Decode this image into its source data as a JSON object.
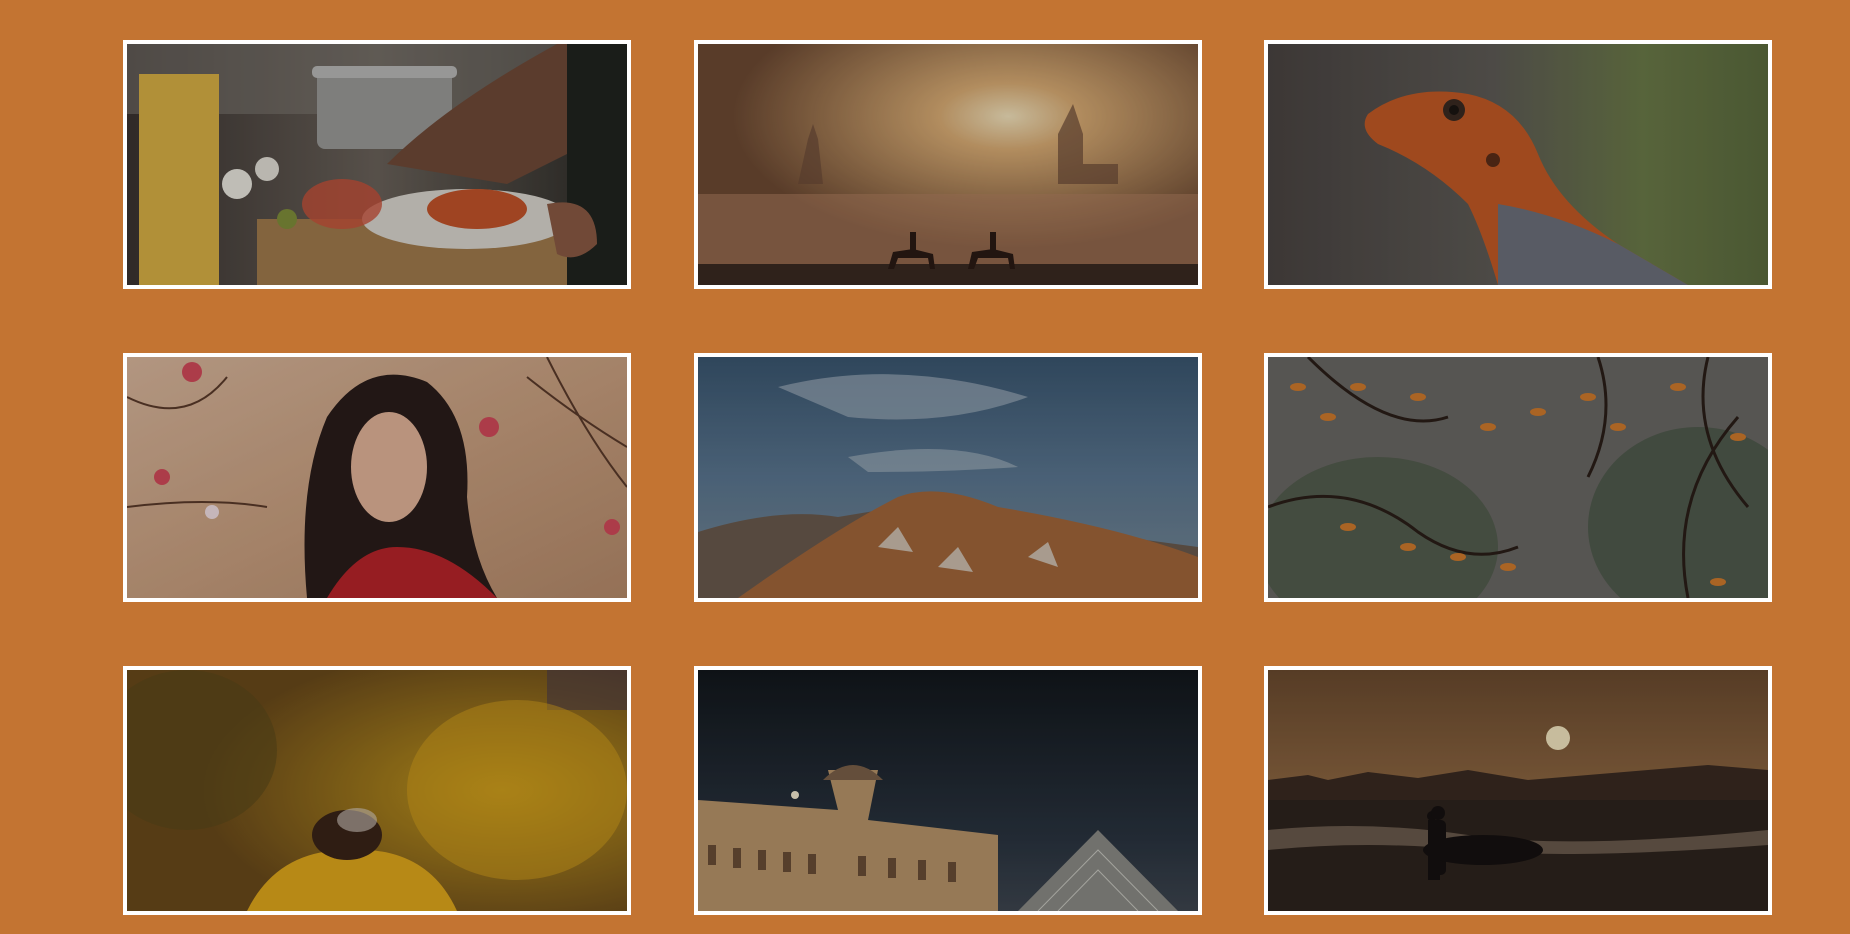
{
  "page": {
    "background": "#c37432",
    "frame_color": "#ffffff"
  },
  "gallery": {
    "tiles": [
      {
        "subject": "chef-plating-pasta",
        "icon": "photo-icon"
      },
      {
        "subject": "horse-riders-misty-sunrise",
        "icon": "photo-icon"
      },
      {
        "subject": "orange-lizard",
        "icon": "photo-icon"
      },
      {
        "subject": "woman-cherry-blossoms",
        "icon": "photo-icon"
      },
      {
        "subject": "mountain-ridge-sky",
        "icon": "photo-icon"
      },
      {
        "subject": "autumn-branches",
        "icon": "photo-icon"
      },
      {
        "subject": "bee-yellow-flower",
        "icon": "photo-icon"
      },
      {
        "subject": "louvre-pyramid-night",
        "icon": "photo-icon"
      },
      {
        "subject": "surfers-sunset-beach",
        "icon": "photo-icon"
      }
    ]
  }
}
